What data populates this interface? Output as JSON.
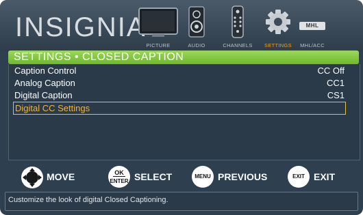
{
  "brand": {
    "logo": "INSIGNIA"
  },
  "nav": {
    "items": [
      {
        "label": "PICTURE",
        "icon": "tv-icon",
        "active": false
      },
      {
        "label": "AUDIO",
        "icon": "speaker-icon",
        "active": false
      },
      {
        "label": "CHANNELS",
        "icon": "remote-icon",
        "active": false
      },
      {
        "label": "SETTINGS",
        "icon": "gear-icon",
        "active": true
      },
      {
        "label": "MHL/ACC",
        "icon": "mhl-icon",
        "mhl_badge": "MHL",
        "active": false
      }
    ]
  },
  "title": "SETTINGS • CLOSED CAPTION",
  "settings": [
    {
      "label": "Caption Control",
      "value": "CC Off"
    },
    {
      "label": "Analog Caption",
      "value": "CC1"
    },
    {
      "label": "Digital Caption",
      "value": "CS1"
    },
    {
      "label": "Digital CC Settings",
      "value": "",
      "selected": true
    }
  ],
  "hints": [
    {
      "button": "",
      "action": "MOVE",
      "icon": "dpad-icon"
    },
    {
      "button": "OK",
      "button2": "ENTER",
      "action": "SELECT",
      "icon": "ok-enter-icon"
    },
    {
      "button": "MENU",
      "action": "PREVIOUS",
      "icon": "menu-button-icon"
    },
    {
      "button": "EXIT",
      "action": "EXIT",
      "icon": "exit-button-icon"
    }
  ],
  "description": "Customize the look of digital Closed Captioning.",
  "colors": {
    "background": "#2e3f4f",
    "title_bar": "#7cc23a",
    "selected_text": "#f1b33a",
    "selected_border": "#e7c23a",
    "active_tab": "#f0a020"
  }
}
